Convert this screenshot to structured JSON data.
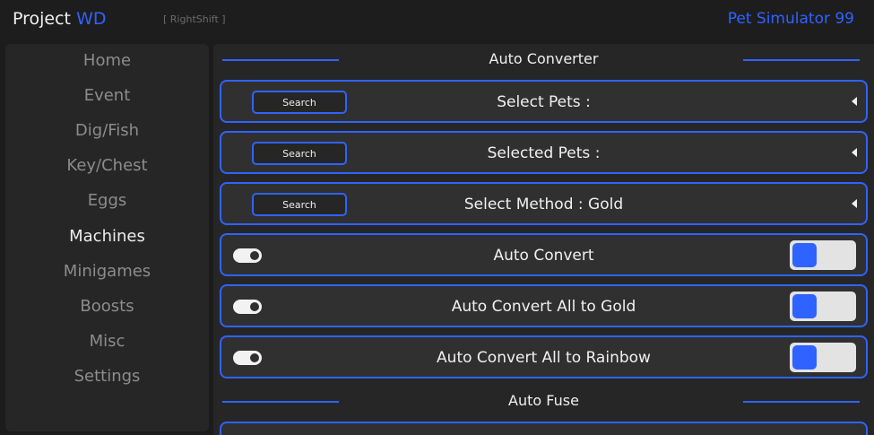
{
  "header": {
    "title_main": "Project",
    "title_accent": "WD",
    "keybind": "[ RightShift ]",
    "game_name": "Pet Simulator 99"
  },
  "sidebar": {
    "items": [
      {
        "label": "Home",
        "active": false
      },
      {
        "label": "Event",
        "active": false
      },
      {
        "label": "Dig/Fish",
        "active": false
      },
      {
        "label": "Key/Chest",
        "active": false
      },
      {
        "label": "Eggs",
        "active": false
      },
      {
        "label": "Machines",
        "active": true
      },
      {
        "label": "Minigames",
        "active": false
      },
      {
        "label": "Boosts",
        "active": false
      },
      {
        "label": "Misc",
        "active": false
      },
      {
        "label": "Settings",
        "active": false
      }
    ]
  },
  "main": {
    "sections": [
      {
        "title": "Auto Converter"
      },
      {
        "title": "Auto Fuse"
      }
    ],
    "dropdowns": [
      {
        "search_label": "Search",
        "label": "Select Pets :"
      },
      {
        "search_label": "Search",
        "label": "Selected Pets :"
      },
      {
        "search_label": "Search",
        "label": "Select Method : Gold"
      }
    ],
    "toggles": [
      {
        "label": "Auto Convert",
        "enabled": false
      },
      {
        "label": "Auto Convert All to Gold",
        "enabled": false
      },
      {
        "label": "Auto Convert All to Rainbow",
        "enabled": false
      }
    ]
  },
  "colors": {
    "accent": "#2f63ff",
    "background": "#1c1c1c",
    "panel": "#262626",
    "row": "#303030",
    "text": "#f0f0f0",
    "muted_text": "#8c8c8c"
  }
}
